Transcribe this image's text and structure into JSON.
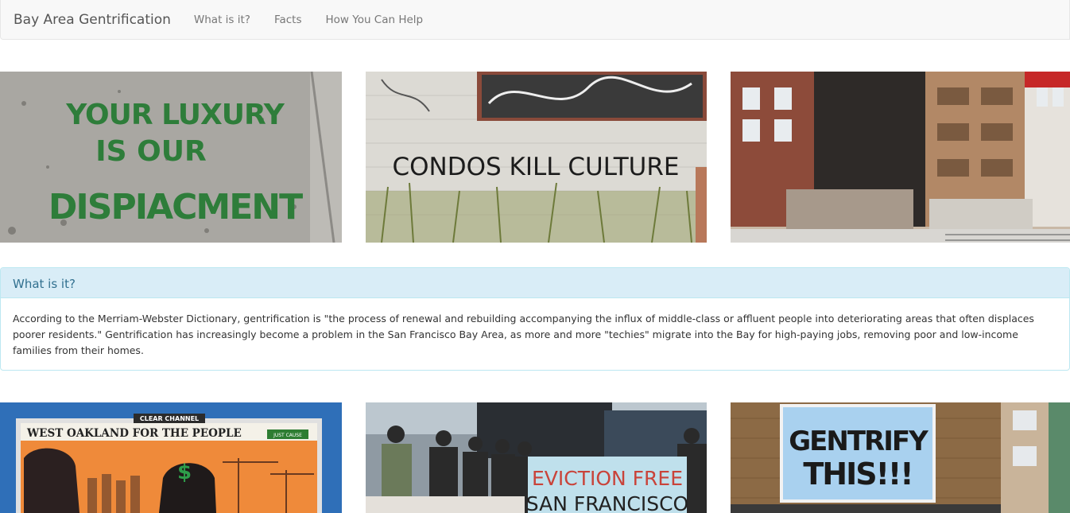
{
  "navbar": {
    "brand": "Bay Area Gentrification",
    "links": [
      "What is it?",
      "Facts",
      "How You Can Help"
    ]
  },
  "images_top": [
    {
      "icon": "stencil-photo",
      "lines": [
        "YOUR LUXURY",
        "IS OUR",
        "DISPIACMENT"
      ]
    },
    {
      "icon": "graffiti-wall-photo",
      "text": "CONDOS KILL CULTURE"
    },
    {
      "icon": "building-construction-photo"
    }
  ],
  "panel": {
    "title": "What is it?",
    "body": "According to the Merriam-Webster Dictionary, gentrification is \"the process of renewal and rebuilding accompanying the influx of middle-class or affluent people into deteriorating areas that often displaces poorer residents.\" Gentrification has increasingly become a problem in the San Francisco Bay Area, as more and more \"techies\" migrate into the Bay for high-paying jobs, removing poor and low-income families from their homes."
  },
  "images_bottom": [
    {
      "icon": "billboard-photo",
      "brand": "CLEAR CHANNEL",
      "text": "WEST OAKLAND FOR THE PEOPLE",
      "tag": "JUST CAUSE"
    },
    {
      "icon": "protest-photo",
      "banner": [
        "EVICTION FREE",
        "SAN FRANCISCO"
      ]
    },
    {
      "icon": "gentrify-billboard-photo",
      "lines": [
        "GENTRIFY",
        "THIS!!!"
      ]
    }
  ],
  "colors": {
    "navbar_bg": "#f8f8f8",
    "panel_heading_bg": "#d9edf7",
    "panel_title": "#31708f",
    "panel_border": "#bce8f1"
  }
}
